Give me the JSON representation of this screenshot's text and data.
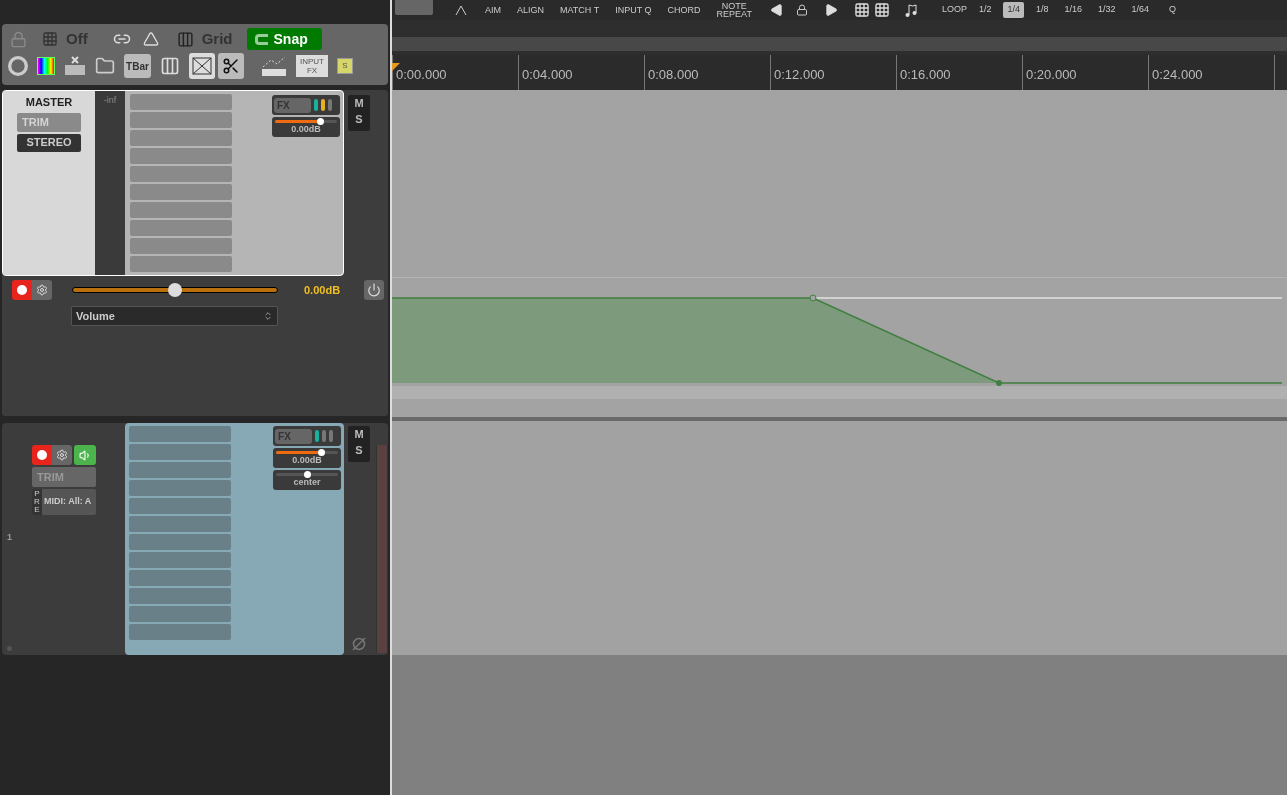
{
  "left_toolbar": {
    "grid_off": "Off",
    "grid": "Grid",
    "snap": {
      "label": "Snap",
      "on": true
    },
    "tbar": "TBar",
    "input_fx": "INPUT\nFX",
    "s": "S",
    "tools": [
      {
        "kind": "cross",
        "selected": true
      },
      {
        "kind": "scissors",
        "selected": true
      }
    ]
  },
  "top_toolbar": {
    "buttons": [
      "AIM",
      "ALIGN",
      "MATCH T",
      "INPUT Q",
      "CHORD",
      "NOTE\nREPEAT"
    ],
    "loop": "LOOP",
    "divisions": [
      {
        "label": "1/2",
        "selected": false
      },
      {
        "label": "1/4",
        "selected": true
      },
      {
        "label": "1/8",
        "selected": false
      },
      {
        "label": "1/16",
        "selected": false
      },
      {
        "label": "1/32",
        "selected": false
      },
      {
        "label": "1/64",
        "selected": false
      }
    ],
    "q": "Q"
  },
  "ruler": [
    "0:00.000",
    "0:04.000",
    "0:08.000",
    "0:12.000",
    "0:16.000",
    "0:20.000",
    "0:24.000"
  ],
  "master": {
    "name": "MASTER",
    "trim": "TRIM",
    "mode": "STEREO",
    "meter": "-inf",
    "fx": "FX",
    "volume": {
      "level": 0.72,
      "reading": "0.00dB"
    },
    "mute": "M",
    "solo": "S"
  },
  "envelope": {
    "armed": true,
    "level": 0.5,
    "reading": "0.00dB",
    "parameter": "Volume"
  },
  "track": {
    "number": "1",
    "armed": true,
    "monitor": true,
    "trim": "TRIM",
    "pre": "PRE",
    "input": "MIDI: All: A",
    "fx": "FX",
    "volume": {
      "level": 0.72,
      "reading": "0.00dB"
    },
    "pan": {
      "level": 0.5,
      "reading": "center"
    },
    "mute": "M",
    "solo": "S"
  }
}
